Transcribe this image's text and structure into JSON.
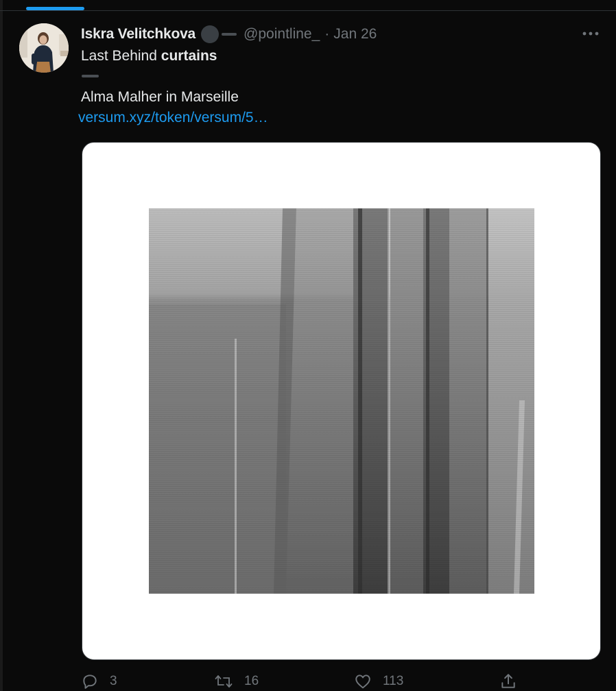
{
  "tweet": {
    "author_name": "Iskra Velitchkova",
    "handle": "@pointline_",
    "separator": "·",
    "date": "Jan 26",
    "text_line1_plain": "Last Behind ",
    "text_line1_bold": "curtains",
    "text_line3": "Alma Malher in Marseille",
    "link_text": "versum.xyz/token/versum/5…"
  },
  "actions": {
    "reply_count": "3",
    "retweet_count": "16",
    "like_count": "113"
  },
  "icons": {
    "more": "more-horizontal-icon",
    "reply": "reply-icon",
    "retweet": "retweet-icon",
    "like": "heart-icon",
    "share": "share-icon"
  },
  "colors": {
    "background": "#000000",
    "text_primary": "#e7e9ea",
    "text_secondary": "#71767b",
    "link": "#1d9bf0",
    "accent": "#1d9bf0"
  }
}
